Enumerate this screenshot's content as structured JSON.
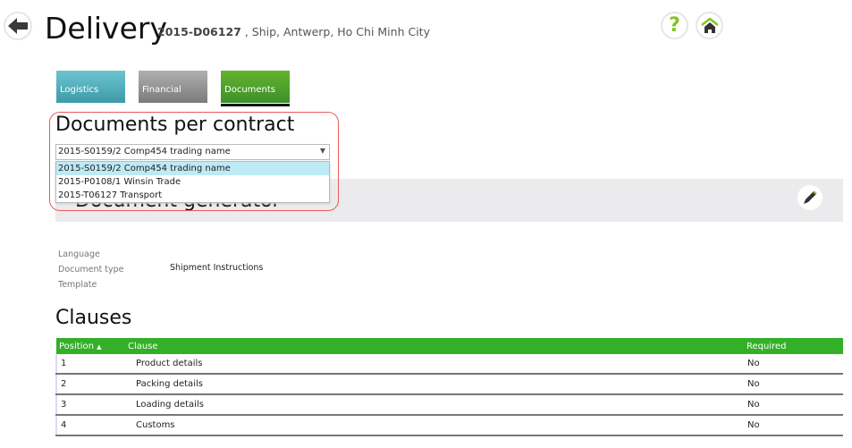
{
  "header": {
    "title": "Delivery",
    "delivery_id": "2015-D06127",
    "route": " , Ship, Antwerp, Ho Chi Minh City"
  },
  "tabs": [
    {
      "label": "Logistics",
      "color": "#4eaebd"
    },
    {
      "label": "Financial",
      "color": "#8a8a8a"
    },
    {
      "label": "Documents",
      "color": "#46a030"
    }
  ],
  "contracts": {
    "title": "Documents per contract",
    "selected": "2015-S0159/2 Comp454 trading name",
    "options": [
      "2015-S0159/2 Comp454 trading name",
      "2015-P0108/1 Winsin Trade",
      "2015-T06127 Transport"
    ]
  },
  "generator": {
    "title": "Document generator",
    "fields": [
      {
        "label": "Language",
        "value": ""
      },
      {
        "label": "Document type",
        "value": "Shipment Instructions"
      },
      {
        "label": "Template",
        "value": ""
      }
    ]
  },
  "clauses": {
    "title": "Clauses",
    "columns": [
      "Position",
      "Clause",
      "Required"
    ],
    "rows": [
      [
        "1",
        "Product details",
        "No"
      ],
      [
        "2",
        "Packing details",
        "No"
      ],
      [
        "3",
        "Loading details",
        "No"
      ],
      [
        "4",
        "Customs",
        "No"
      ]
    ]
  }
}
